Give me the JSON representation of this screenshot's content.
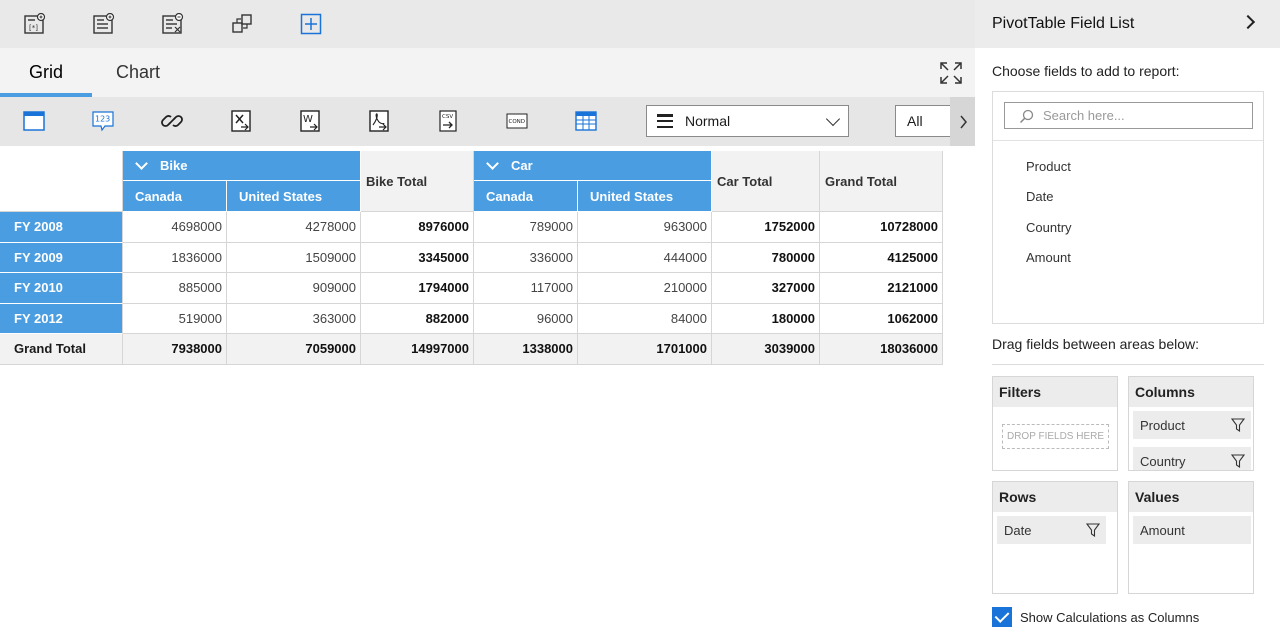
{
  "toolbar": {
    "icons": [
      "formula-icon",
      "add-field-icon",
      "edit-field-icon",
      "swap-axes-icon",
      "expand-all-icon"
    ]
  },
  "tabs": [
    {
      "label": "Grid",
      "active": true
    },
    {
      "label": "Chart",
      "active": false
    }
  ],
  "export": {
    "icons": [
      "grid-layout-icon",
      "number-format-icon",
      "hyperlink-icon",
      "excel-export-icon",
      "word-export-icon",
      "pdf-export-icon",
      "csv-export-icon",
      "conditional-format-icon",
      "grid-view-icon"
    ],
    "csv_text": "CSV",
    "cond_text": "COND",
    "num_text": "123",
    "mode_value": "Normal",
    "all_value": "All"
  },
  "grid": {
    "groups": [
      {
        "label": "Bike",
        "total_label": "Bike Total"
      },
      {
        "label": "Car",
        "total_label": "Car Total"
      }
    ],
    "countries": [
      "Canada",
      "United States",
      "Canada",
      "United States"
    ],
    "grand_total_col": "Grand Total",
    "rows": [
      {
        "label": "FY 2008",
        "values": [
          "4698000",
          "4278000",
          "8976000",
          "789000",
          "963000",
          "1752000",
          "10728000"
        ]
      },
      {
        "label": "FY 2009",
        "values": [
          "1836000",
          "1509000",
          "3345000",
          "336000",
          "444000",
          "780000",
          "4125000"
        ]
      },
      {
        "label": "FY 2010",
        "values": [
          "885000",
          "909000",
          "1794000",
          "117000",
          "210000",
          "327000",
          "2121000"
        ]
      },
      {
        "label": "FY 2012",
        "values": [
          "519000",
          "363000",
          "882000",
          "96000",
          "84000",
          "180000",
          "1062000"
        ]
      }
    ],
    "grand_total_row": {
      "label": "Grand Total",
      "values": [
        "7938000",
        "7059000",
        "14997000",
        "1338000",
        "1701000",
        "3039000",
        "18036000"
      ]
    }
  },
  "panel": {
    "title": "PivotTable Field List",
    "choose_label": "Choose fields to add to report:",
    "search_placeholder": "Search here...",
    "fields": [
      "Product",
      "Date",
      "Country",
      "Amount"
    ],
    "drag_label": "Drag fields between areas below:",
    "areas": {
      "filters": {
        "title": "Filters",
        "drop_text": "DROP FIELDS HERE"
      },
      "columns": {
        "title": "Columns",
        "items": [
          "Product",
          "Country"
        ]
      },
      "rows": {
        "title": "Rows",
        "items": [
          "Date"
        ]
      },
      "values": {
        "title": "Values",
        "items": [
          "Amount"
        ]
      }
    },
    "show_calc_label": "Show Calculations as Columns",
    "show_calc_checked": true
  },
  "colors": {
    "accent": "#4a9de0",
    "checkbox": "#1a73d8"
  }
}
